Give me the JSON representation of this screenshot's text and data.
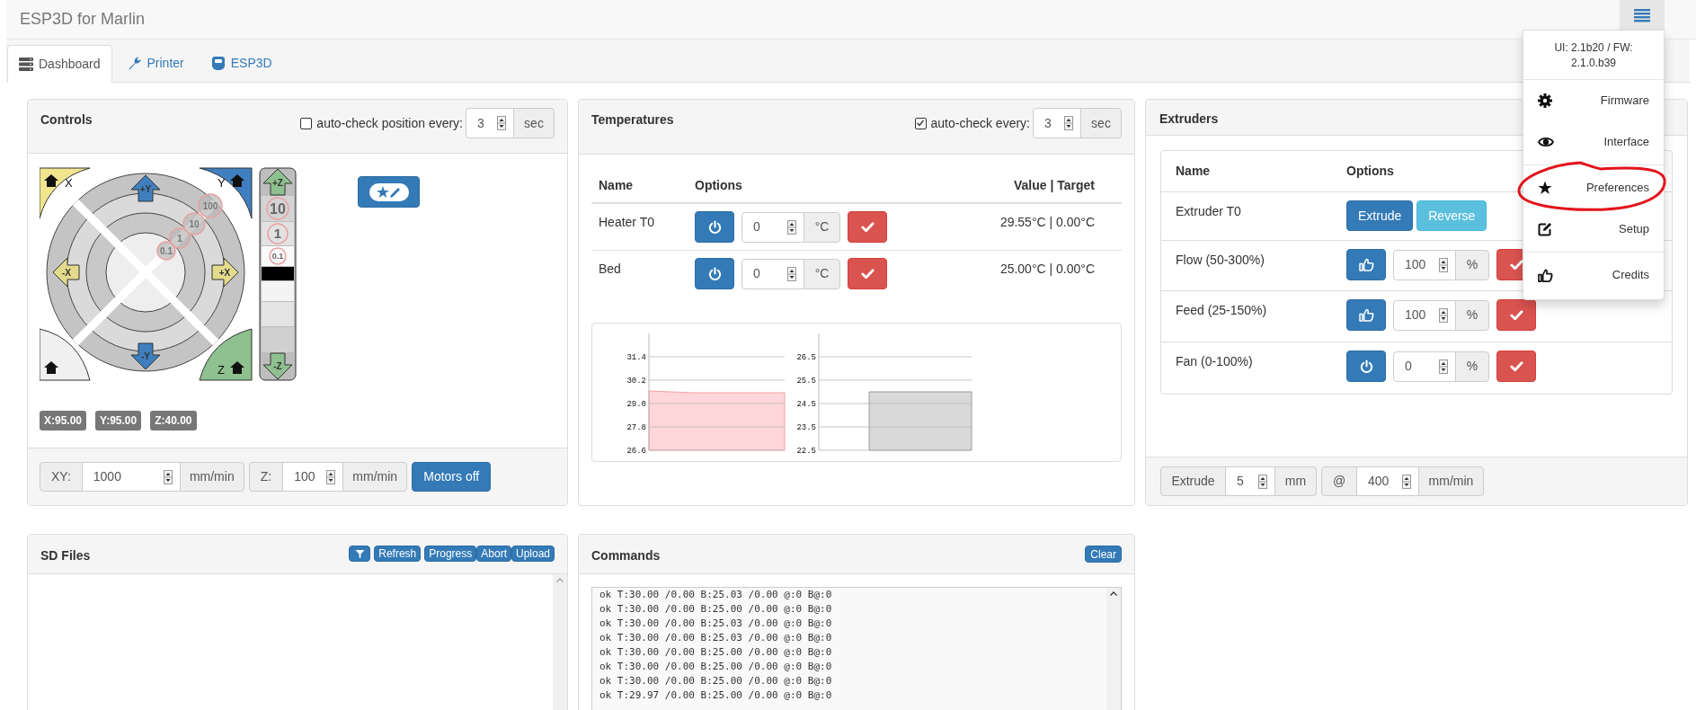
{
  "header": {
    "title": "ESP3D for Marlin"
  },
  "menu": {
    "version": "UI: 2.1b20 / FW: 2.1.0.b39",
    "items": [
      {
        "label": "Firmware",
        "divider_before": false,
        "circled": false
      },
      {
        "label": "Interface",
        "divider_before": false,
        "circled": false
      },
      {
        "label": "Preferences",
        "divider_before": true,
        "circled": true
      },
      {
        "label": "Setup",
        "divider_before": false,
        "circled": false
      },
      {
        "label": "Credits",
        "divider_before": true,
        "circled": false
      }
    ]
  },
  "tabs": [
    {
      "label": "Dashboard",
      "selected": true
    },
    {
      "label": "Printer",
      "selected": false
    },
    {
      "label": "ESP3D",
      "selected": false
    }
  ],
  "controls": {
    "title": "Controls",
    "auto_check": {
      "label": "auto-check position every:",
      "checked": false,
      "value": "3",
      "unit": "sec"
    },
    "jog": {
      "home_labels": [
        "X",
        "Y",
        "Z"
      ],
      "arrows": [
        "+Y",
        "-Y",
        "-X",
        "+X"
      ],
      "xy_steps": [
        "100",
        "10",
        "1",
        "0.1"
      ],
      "z_arrows": [
        "+Z",
        "-Z"
      ],
      "z_steps": [
        "10",
        "1",
        "0.1"
      ]
    },
    "positions": [
      "X:95.00",
      "Y:95.00",
      "Z:40.00"
    ],
    "feedrates": [
      {
        "label": "XY:",
        "value": "1000",
        "unit": "mm/min"
      },
      {
        "label": "Z:",
        "value": "100",
        "unit": "mm/min"
      }
    ],
    "motors_button": "Motors off"
  },
  "temperatures": {
    "title": "Temperatures",
    "auto_check": {
      "label": "auto-check every:",
      "checked": true,
      "value": "3",
      "unit": "sec"
    },
    "columns": [
      "Name",
      "Options",
      "Value | Target"
    ],
    "rows": [
      {
        "name": "Heater T0",
        "value": "0",
        "unit": "°C",
        "reading": "29.55°C | 0.00°C"
      },
      {
        "name": "Bed",
        "value": "0",
        "unit": "°C",
        "reading": "25.00°C | 0.00°C"
      }
    ],
    "charts": [
      {
        "y_labels": [
          "31.4",
          "30.2",
          "29.0",
          "27.8",
          "26.6"
        ]
      },
      {
        "y_labels": [
          "26.5",
          "25.5",
          "24.5",
          "23.5",
          "22.5"
        ]
      }
    ]
  },
  "extruders": {
    "title": "Extruders",
    "columns": [
      "Name",
      "Options"
    ],
    "rows": [
      {
        "kind": "actions",
        "name": "Extruder T0",
        "buttons": [
          "Extrude",
          "Reverse"
        ]
      },
      {
        "kind": "setter",
        "name": "Flow (50-300%)",
        "value": "100",
        "unit": "%"
      },
      {
        "kind": "setter",
        "name": "Feed (25-150%)",
        "value": "100",
        "unit": "%"
      },
      {
        "kind": "setter",
        "name": "Fan (0-100%)",
        "value": "0",
        "unit": "%"
      }
    ],
    "footer": {
      "label": "Extrude",
      "value": "5",
      "unit": "mm",
      "at": "@",
      "speed": "400",
      "speed_unit": "mm/min"
    }
  },
  "sd_files": {
    "title": "SD Files",
    "buttons": [
      "Refresh",
      "Progress",
      "Abort",
      "Upload"
    ]
  },
  "commands": {
    "title": "Commands",
    "clear": "Clear",
    "log": [
      "ok T:30.00 /0.00 B:25.03 /0.00 @:0 B@:0",
      "ok T:30.00 /0.00 B:25.00 /0.00 @:0 B@:0",
      "ok T:30.00 /0.00 B:25.03 /0.00 @:0 B@:0",
      "ok T:30.00 /0.00 B:25.03 /0.00 @:0 B@:0",
      "ok T:30.00 /0.00 B:25.00 /0.00 @:0 B@:0",
      "ok T:30.00 /0.00 B:25.00 /0.00 @:0 B@:0",
      "ok T:30.00 /0.00 B:25.00 /0.00 @:0 B@:0",
      "ok T:29.97 /0.00 B:25.00 /0.00 @:0 B@:0"
    ]
  }
}
